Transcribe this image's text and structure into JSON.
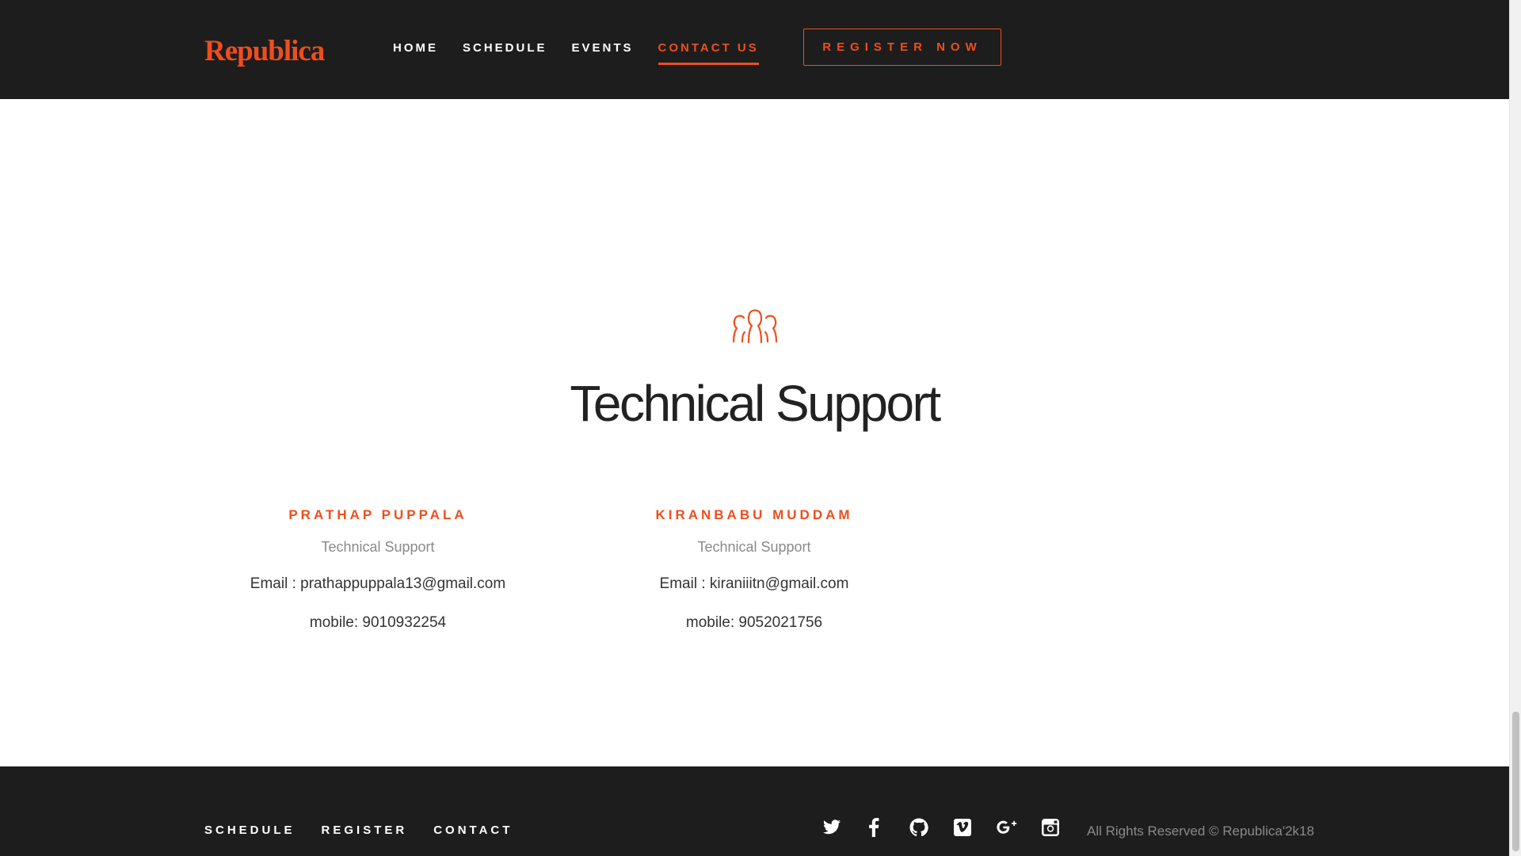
{
  "header": {
    "logo": "Republica",
    "nav": [
      {
        "label": "HOME",
        "active": false
      },
      {
        "label": "SCHEDULE",
        "active": false
      },
      {
        "label": "EVENTS",
        "active": false
      },
      {
        "label": "CONTACT US",
        "active": true
      }
    ],
    "register_button": "REGISTER NOW"
  },
  "main": {
    "section_icon": "team-icon",
    "title": "Technical Support",
    "contacts": [
      {
        "name": "PRATHAP PUPPALA",
        "role": "Technical Support",
        "email": "Email : prathappuppala13@gmail.com",
        "mobile": "mobile: 9010932254"
      },
      {
        "name": "KIRANBABU MUDDAM",
        "role": "Technical Support",
        "email": "Email : kiraniiitn@gmail.com",
        "mobile": "mobile: 9052021756"
      }
    ]
  },
  "footer": {
    "links": [
      "SCHEDULE",
      "REGISTER",
      "CONTACT"
    ],
    "social_icons": [
      "twitter-icon",
      "facebook-icon",
      "github-icon",
      "vimeo-icon",
      "google-plus-icon",
      "instagram-icon"
    ],
    "copyright": "All Rights Reserved © Republica'2k18"
  },
  "colors": {
    "accent": "#ee4e1d",
    "dark_background": "#1d1d1d",
    "muted_text": "#8a8a8a",
    "body_text": "#333333"
  }
}
